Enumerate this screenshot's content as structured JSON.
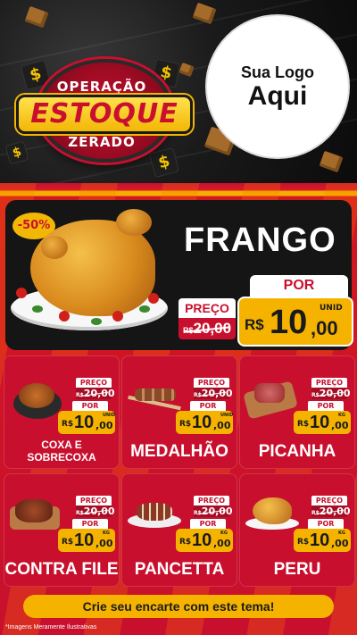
{
  "header": {
    "badge_top": "OPERAÇÃO",
    "badge_mid": "ESTOQUE",
    "badge_bottom": "ZERADO",
    "logo_line1": "Sua Logo",
    "logo_line2": "Aqui",
    "cube_symbol": "$"
  },
  "hero": {
    "discount": "-50%",
    "name": "FRANGO",
    "old_label": "PREÇO",
    "old_currency": "R$",
    "old_price": "20,00",
    "new_label": "POR",
    "currency": "R$",
    "price_int": "10",
    "price_dec": ",00",
    "unit": "UNID"
  },
  "cards": [
    {
      "title_line1": "COXA E",
      "title_line2": "SOBRECOXA",
      "old_label": "PREÇO",
      "old_currency": "R$",
      "old_price": "20,00",
      "new_label": "POR",
      "currency": "R$",
      "price_int": "10",
      "price_dec": ",00",
      "unit": "UNID",
      "image": "chicken-pot"
    },
    {
      "title_line1": "MEDALHÃO",
      "title_line2": "",
      "old_label": "PREÇO",
      "old_currency": "R$",
      "old_price": "20,00",
      "new_label": "POR",
      "currency": "R$",
      "price_int": "10",
      "price_dec": ",00",
      "unit": "UNID",
      "image": "skewers"
    },
    {
      "title_line1": "PICANHA",
      "title_line2": "",
      "old_label": "PREÇO",
      "old_currency": "R$",
      "old_price": "20,00",
      "new_label": "POR",
      "currency": "R$",
      "price_int": "10",
      "price_dec": ",00",
      "unit": "KG",
      "image": "picanha-board"
    },
    {
      "title_line1": "CONTRA FILE",
      "title_line2": "",
      "old_label": "PREÇO",
      "old_currency": "R$",
      "old_price": "20,00",
      "new_label": "POR",
      "currency": "R$",
      "price_int": "10",
      "price_dec": ",00",
      "unit": "KG",
      "image": "steak"
    },
    {
      "title_line1": "PANCETTA",
      "title_line2": "",
      "old_label": "PREÇO",
      "old_currency": "R$",
      "old_price": "20,00",
      "new_label": "POR",
      "currency": "R$",
      "price_int": "10",
      "price_dec": ",00",
      "unit": "KG",
      "image": "pancetta"
    },
    {
      "title_line1": "PERU",
      "title_line2": "",
      "old_label": "PREÇO",
      "old_currency": "R$",
      "old_price": "20,00",
      "new_label": "POR",
      "currency": "R$",
      "price_int": "10",
      "price_dec": ",00",
      "unit": "KG",
      "image": "turkey"
    }
  ],
  "cta": "Crie seu encarte com este tema!",
  "footnote": "*Imagens Meramente Ilustrativas",
  "colors": {
    "red": "#c8102e",
    "yellow": "#f5b300",
    "dark": "#151515"
  }
}
